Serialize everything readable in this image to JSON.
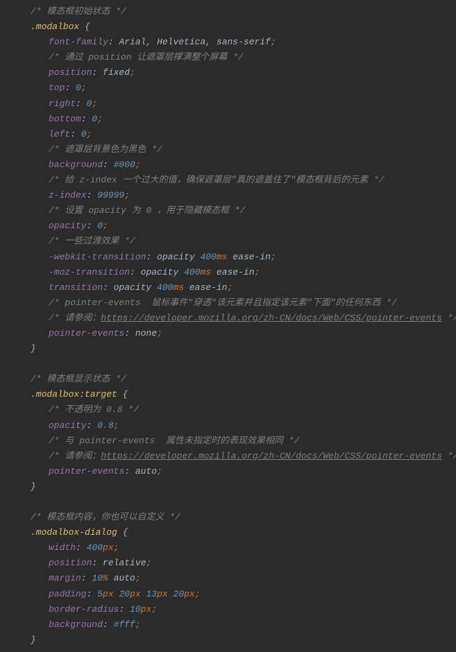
{
  "lines": [
    {
      "ind": 1,
      "t": "comment",
      "text": "/* 模态框初始状态 */"
    },
    {
      "ind": 1,
      "t": "sel-open",
      "sel": ".modalbox"
    },
    {
      "ind": 2,
      "t": "decl-idents",
      "prop": "font-family",
      "idents": [
        "Arial",
        "Helvetica",
        "sans-serif"
      ]
    },
    {
      "ind": 2,
      "t": "comment",
      "text": "/* 通过 position 让遮罩层撑满整个屏幕 */"
    },
    {
      "ind": 2,
      "t": "decl-ident",
      "prop": "position",
      "ident": "fixed"
    },
    {
      "ind": 2,
      "t": "decl-num",
      "prop": "top",
      "num": "0"
    },
    {
      "ind": 2,
      "t": "decl-num",
      "prop": "right",
      "num": "0"
    },
    {
      "ind": 2,
      "t": "decl-num",
      "prop": "bottom",
      "num": "0"
    },
    {
      "ind": 2,
      "t": "decl-num",
      "prop": "left",
      "num": "0"
    },
    {
      "ind": 2,
      "t": "comment",
      "text": "/* 遮罩层背景色为黑色 */"
    },
    {
      "ind": 2,
      "t": "decl-num",
      "prop": "background",
      "num": "#000"
    },
    {
      "ind": 2,
      "t": "comment",
      "text": "/* 给 z-index 一个过大的值，确保遮罩层\"真的遮盖住了\"模态框背后的元素 */"
    },
    {
      "ind": 2,
      "t": "decl-num",
      "prop": "z-index",
      "num": "99999"
    },
    {
      "ind": 2,
      "t": "comment",
      "text": "/* 设置 opacity 为 0 ，用于隐藏模态框 */"
    },
    {
      "ind": 2,
      "t": "decl-num",
      "prop": "opacity",
      "num": "0"
    },
    {
      "ind": 2,
      "t": "comment",
      "text": "/* 一些过渡效果 */"
    },
    {
      "ind": 2,
      "t": "decl-trans",
      "prop": "-webkit-transition",
      "ident1": "opacity",
      "num": "400",
      "unit": "ms",
      "ident2": "ease-in"
    },
    {
      "ind": 2,
      "t": "decl-trans",
      "prop": "-moz-transition",
      "ident1": "opacity",
      "num": "400",
      "unit": "ms",
      "ident2": "ease-in"
    },
    {
      "ind": 2,
      "t": "decl-trans",
      "prop": "transition",
      "ident1": "opacity",
      "num": "400",
      "unit": "ms",
      "ident2": "ease-in"
    },
    {
      "ind": 2,
      "t": "comment",
      "text": "/* pointer-events  鼠标事件\"穿透\"该元素并且指定该元素\"下面\"的任何东西 */"
    },
    {
      "ind": 2,
      "t": "comment-url",
      "pre": "/* 请参阅：",
      "url": "https://developer.mozilla.org/zh-CN/docs/Web/CSS/pointer-events",
      "post": " */"
    },
    {
      "ind": 2,
      "t": "decl-ident",
      "prop": "pointer-events",
      "ident": "none"
    },
    {
      "ind": 1,
      "t": "close"
    },
    {
      "ind": 0,
      "t": "blank"
    },
    {
      "ind": 1,
      "t": "comment",
      "text": "/* 模态框显示状态 */"
    },
    {
      "ind": 1,
      "t": "sel-open",
      "sel": ".modalbox:target"
    },
    {
      "ind": 2,
      "t": "comment",
      "text": "/* 不透明为 0.8 */"
    },
    {
      "ind": 2,
      "t": "decl-num",
      "prop": "opacity",
      "num": "0.8"
    },
    {
      "ind": 2,
      "t": "comment",
      "text": "/* 与 pointer-events  属性未指定时的表现效果相同 */"
    },
    {
      "ind": 2,
      "t": "comment-url",
      "pre": "/* 请参阅：",
      "url": "https://developer.mozilla.org/zh-CN/docs/Web/CSS/pointer-events",
      "post": " */"
    },
    {
      "ind": 2,
      "t": "decl-ident",
      "prop": "pointer-events",
      "ident": "auto"
    },
    {
      "ind": 1,
      "t": "close"
    },
    {
      "ind": 0,
      "t": "blank"
    },
    {
      "ind": 1,
      "t": "comment",
      "text": "/* 模态框内容，你也可以自定义 */"
    },
    {
      "ind": 1,
      "t": "sel-open",
      "sel": ".modalbox-dialog"
    },
    {
      "ind": 2,
      "t": "decl-numunit",
      "prop": "width",
      "num": "400",
      "unit": "px"
    },
    {
      "ind": 2,
      "t": "decl-ident",
      "prop": "position",
      "ident": "relative"
    },
    {
      "ind": 2,
      "t": "decl-margin",
      "prop": "margin",
      "num": "10",
      "unit": "%",
      "ident": "auto"
    },
    {
      "ind": 2,
      "t": "decl-padding",
      "prop": "padding",
      "vals": [
        [
          "5",
          "px"
        ],
        [
          "20",
          "px"
        ],
        [
          "13",
          "px"
        ],
        [
          "20",
          "px"
        ]
      ]
    },
    {
      "ind": 2,
      "t": "decl-numunit",
      "prop": "border-radius",
      "num": "10",
      "unit": "px"
    },
    {
      "ind": 2,
      "t": "decl-num",
      "prop": "background",
      "num": "#fff"
    },
    {
      "ind": 1,
      "t": "close"
    }
  ]
}
